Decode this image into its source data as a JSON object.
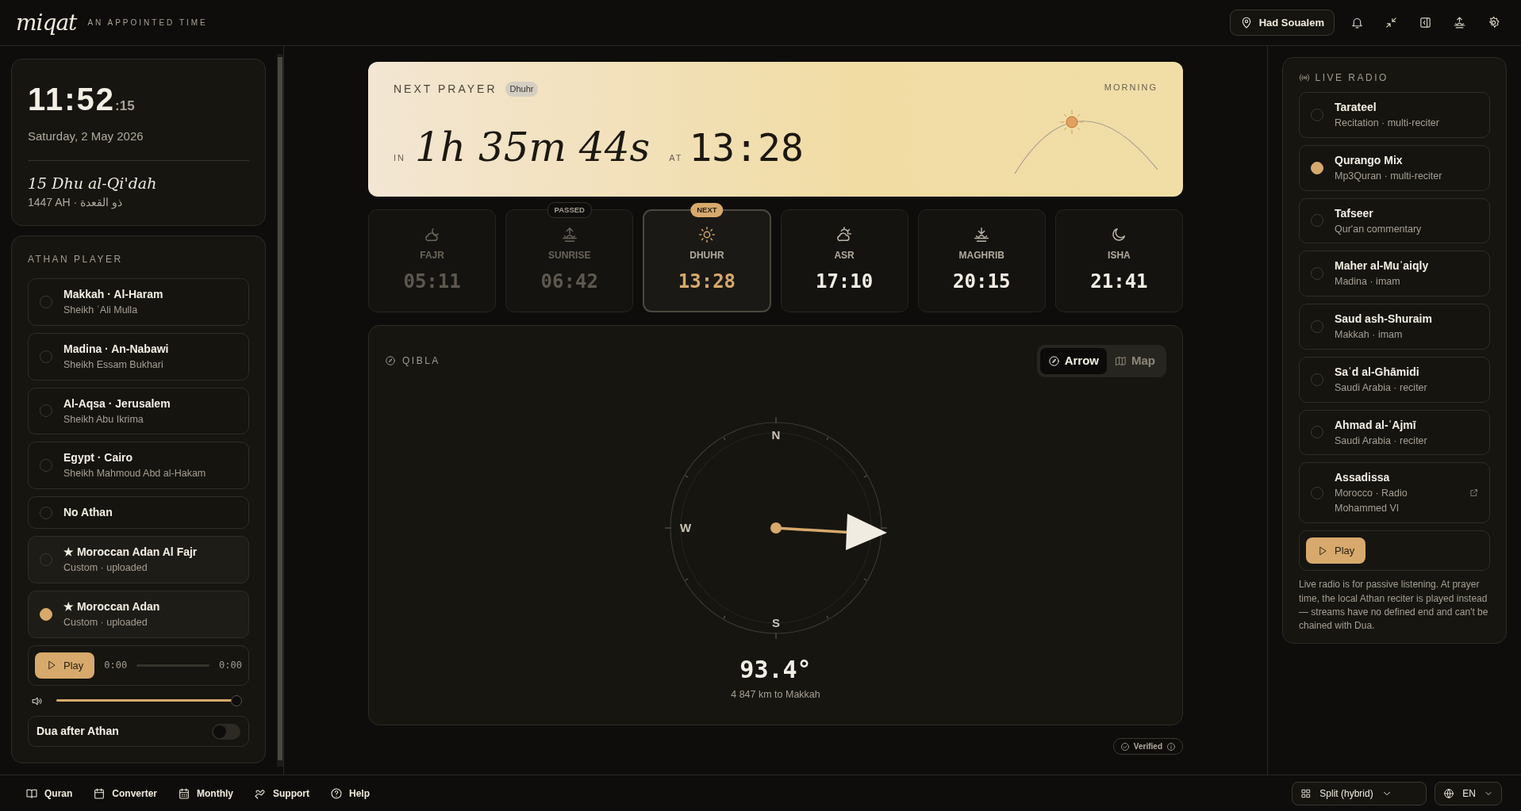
{
  "header": {
    "logo": "miqat",
    "tagline": "AN APPOINTED TIME",
    "location": "Had Soualem"
  },
  "clock": {
    "hm": "11:52",
    "seconds": ":15",
    "date": "Saturday, 2 May 2026",
    "hijri": "15 Dhu al-Qi'dah",
    "hijri_sub": "1447 AH · ذو القعدة"
  },
  "athan": {
    "title": "ATHAN PLAYER",
    "items": [
      {
        "name": "Makkah · Al-Haram",
        "sub": "Sheikh ʿAli Mulla",
        "kind": "preset",
        "selected": false
      },
      {
        "name": "Madina · An-Nabawi",
        "sub": "Sheikh Essam Bukhari",
        "kind": "preset",
        "selected": false
      },
      {
        "name": "Al-Aqsa · Jerusalem",
        "sub": "Sheikh Abu Ikrima",
        "kind": "preset",
        "selected": false
      },
      {
        "name": "Egypt · Cairo",
        "sub": "Sheikh Mahmoud Abd al-Hakam",
        "kind": "preset",
        "selected": false
      },
      {
        "name": "No Athan",
        "kind": "preset",
        "selected": false
      },
      {
        "name": "★ Moroccan Adan Al Fajr",
        "sub": "Custom · uploaded",
        "kind": "custom",
        "selected": false
      },
      {
        "name": "★ Moroccan Adan",
        "sub": "Custom · uploaded",
        "kind": "custom",
        "selected": true
      }
    ],
    "play": "Play",
    "elapsed": "0:00",
    "total": "0:00",
    "progress": {
      "level": 0
    },
    "volume": {
      "level": 0.98
    },
    "dua": {
      "label": "Dua after Athan",
      "on": false
    }
  },
  "next_prayer": {
    "label": "NEXT PRAYER",
    "name": "Dhuhr",
    "in": "IN",
    "countdown": "1h 35m 44s",
    "at": "AT",
    "time": "13:28",
    "phase": "MORNING"
  },
  "prayers": [
    {
      "name": "FAJR",
      "time": "05:11",
      "passed": true,
      "next": false
    },
    {
      "name": "SUNRISE",
      "time": "06:42",
      "passed": true,
      "next": false,
      "badge": "PASSED"
    },
    {
      "name": "DHUHR",
      "time": "13:28",
      "passed": false,
      "next": true,
      "badge": "NEXT"
    },
    {
      "name": "ASR",
      "time": "17:10",
      "passed": false,
      "next": false
    },
    {
      "name": "MAGHRIB",
      "time": "20:15",
      "passed": false,
      "next": false
    },
    {
      "name": "ISHA",
      "time": "21:41",
      "passed": false,
      "next": false
    }
  ],
  "qibla": {
    "title": "QIBLA",
    "modes": [
      {
        "label": "Arrow",
        "selected": true
      },
      {
        "label": "Map",
        "selected": false
      }
    ],
    "cardinals": [
      "N",
      "W",
      "S"
    ],
    "bearing": "93.4°",
    "distance": "4 847 km to Makkah",
    "verified": "Verified"
  },
  "radio": {
    "title": "LIVE RADIO",
    "items": [
      {
        "name": "Tarateel",
        "sub": "Recitation · multi-reciter",
        "selected": false
      },
      {
        "name": "Qurango Mix",
        "sub": "Mp3Quran · multi-reciter",
        "selected": true
      },
      {
        "name": "Tafseer",
        "sub": "Qur'an commentary",
        "selected": false
      },
      {
        "name": "Maher al-Muʿaiqly",
        "sub": "Madina · imam",
        "selected": false
      },
      {
        "name": "Saud ash-Shuraim",
        "sub": "Makkah · imam",
        "selected": false
      },
      {
        "name": "Saʿd al-Ghāmidi",
        "sub": "Saudi Arabia · reciter",
        "selected": false
      },
      {
        "name": "Ahmad al-ʿAjmī",
        "sub": "Saudi Arabia · reciter",
        "selected": false
      },
      {
        "name": "Assadissa",
        "sub": "Morocco · Radio Mohammed VI",
        "selected": false,
        "external": true
      }
    ],
    "play": "Play",
    "note": "Live radio is for passive listening. At prayer time, the local Athan reciter is played instead — streams have no defined end and can't be chained with Dua."
  },
  "footer": {
    "links": [
      {
        "label": "Quran"
      },
      {
        "label": "Converter"
      },
      {
        "label": "Monthly"
      },
      {
        "label": "Support"
      },
      {
        "label": "Help"
      }
    ],
    "layout": "Split (hybrid)",
    "language": "EN"
  }
}
